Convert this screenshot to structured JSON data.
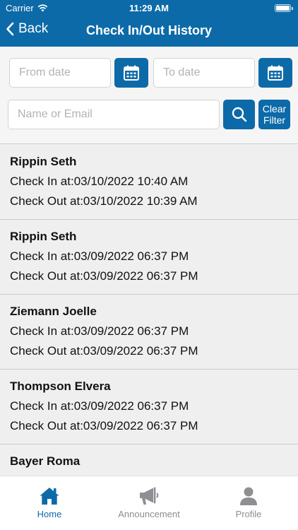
{
  "status_bar": {
    "carrier": "Carrier",
    "time": "11:29 AM"
  },
  "nav": {
    "back_label": "Back",
    "title": "Check In/Out History"
  },
  "filters": {
    "from_placeholder": "From date",
    "to_placeholder": "To date",
    "search_placeholder": "Name or Email",
    "clear_label_line1": "Clear",
    "clear_label_line2": "Filter"
  },
  "records": [
    {
      "name": "Rippin Seth",
      "check_in": "Check In at:03/10/2022 10:40 AM",
      "check_out": "Check Out at:03/10/2022 10:39 AM"
    },
    {
      "name": "Rippin Seth",
      "check_in": "Check In at:03/09/2022 06:37 PM",
      "check_out": "Check Out at:03/09/2022 06:37 PM"
    },
    {
      "name": "Ziemann Joelle",
      "check_in": "Check In at:03/09/2022 06:37 PM",
      "check_out": "Check Out at:03/09/2022 06:37 PM"
    },
    {
      "name": "Thompson Elvera",
      "check_in": "Check In at:03/09/2022 06:37 PM",
      "check_out": "Check Out at:03/09/2022 06:37 PM"
    },
    {
      "name": "Bayer Roma",
      "check_in": "",
      "check_out": ""
    }
  ],
  "tabbar": {
    "home_label": "Home",
    "announcement_label": "Announcement",
    "profile_label": "Profile",
    "icons": {
      "home": "home-icon",
      "announcement": "megaphone-icon",
      "profile": "person-icon"
    }
  },
  "colors": {
    "brand": "#0d6aa8",
    "inactive_tab": "#8e8e93",
    "list_background": "#efefef"
  }
}
